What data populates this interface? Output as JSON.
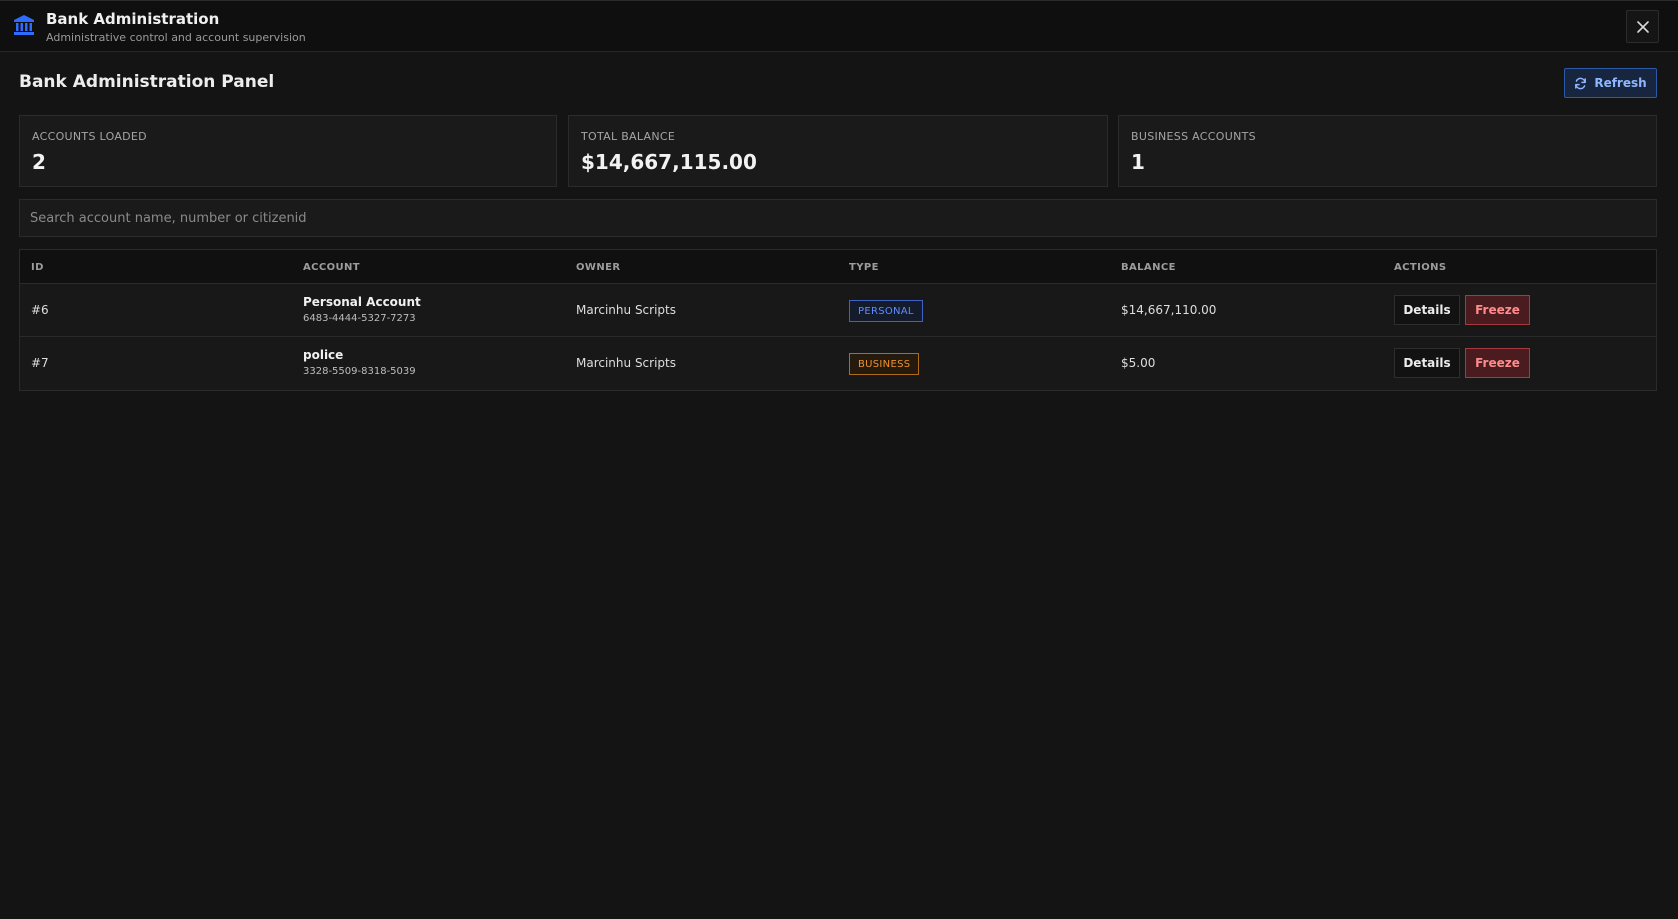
{
  "header": {
    "icon": "bank-icon",
    "title": "Bank Administration",
    "subtitle": "Administrative control and account supervision",
    "close_icon": "close-icon"
  },
  "panel": {
    "title": "Bank Administration Panel",
    "refresh_label": "Refresh",
    "refresh_icon": "refresh-icon"
  },
  "stats": [
    {
      "label": "ACCOUNTS LOADED",
      "value": "2"
    },
    {
      "label": "TOTAL BALANCE",
      "value": "$14,667,115.00"
    },
    {
      "label": "BUSINESS ACCOUNTS",
      "value": "1"
    }
  ],
  "search": {
    "placeholder": "Search account name, number or citizenid",
    "value": ""
  },
  "table": {
    "columns": [
      "ID",
      "ACCOUNT",
      "OWNER",
      "TYPE",
      "BALANCE",
      "ACTIONS"
    ],
    "rows": [
      {
        "id": "#6",
        "account_name": "Personal Account",
        "account_number": "6483-4444-5327-7273",
        "owner": "Marcinhu Scripts",
        "type": "PERSONAL",
        "balance": "$14,667,110.00",
        "details_label": "Details",
        "freeze_label": "Freeze"
      },
      {
        "id": "#7",
        "account_name": "police",
        "account_number": "3328-5509-8318-5039",
        "owner": "Marcinhu Scripts",
        "type": "BUSINESS",
        "balance": "$5.00",
        "details_label": "Details",
        "freeze_label": "Freeze"
      }
    ]
  },
  "colors": {
    "accent_blue": "#2f6bff",
    "personal_badge": "#5f8dff",
    "business_badge": "#f2922e",
    "freeze_red": "#ff8c8c"
  }
}
